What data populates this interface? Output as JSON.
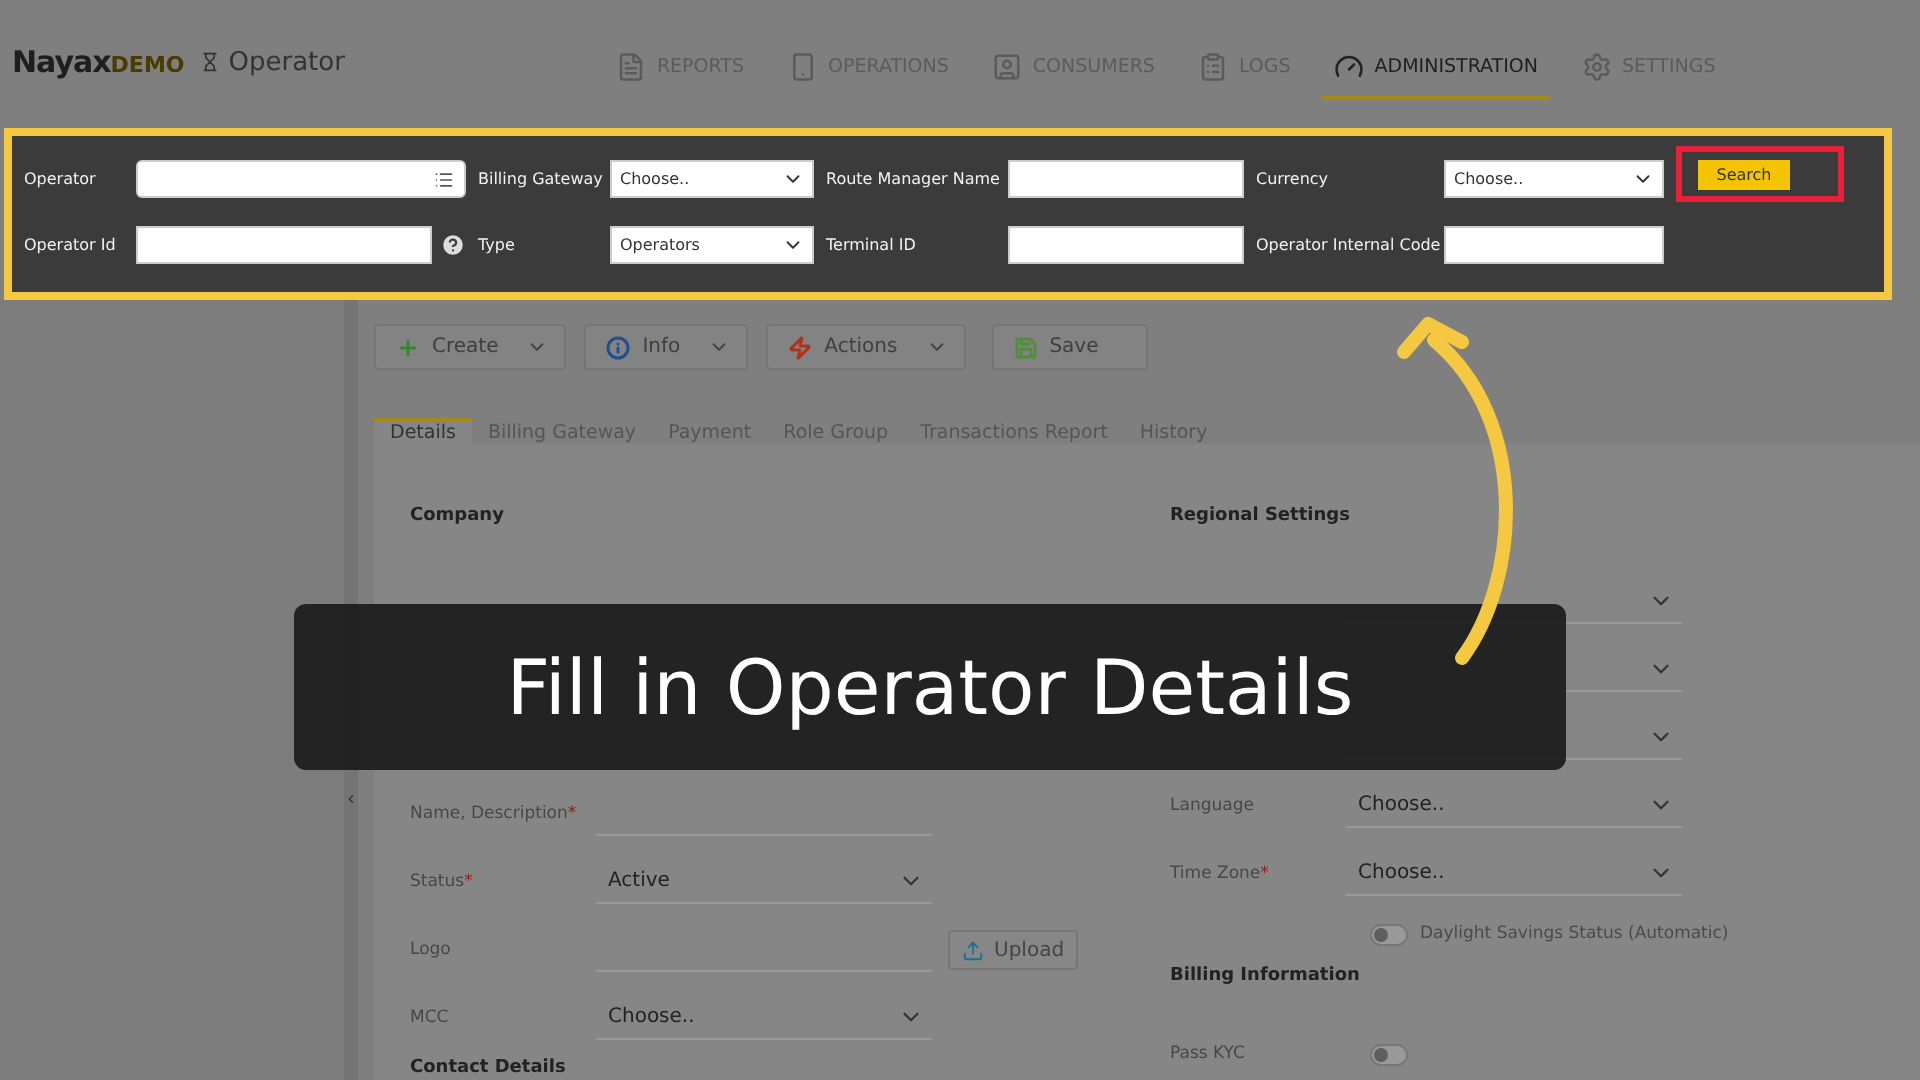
{
  "header": {
    "logo": "Nayax",
    "logo_badge": "DEMO",
    "app_name": "Operator"
  },
  "nav": [
    {
      "label": "REPORTS",
      "selected": false
    },
    {
      "label": "OPERATIONS",
      "selected": false
    },
    {
      "label": "CONSUMERS",
      "selected": false
    },
    {
      "label": "LOGS",
      "selected": false
    },
    {
      "label": "ADMINISTRATION",
      "selected": true
    },
    {
      "label": "SETTINGS",
      "selected": false
    }
  ],
  "search_panel": {
    "fields": [
      {
        "label": "Operator",
        "kind": "lookup"
      },
      {
        "label": "Billing Gateway",
        "kind": "select",
        "value": "Choose.."
      },
      {
        "label": "Route Manager Name",
        "kind": "text"
      },
      {
        "label": "Currency",
        "kind": "select",
        "value": "Choose.."
      },
      {
        "label": "Operator Id",
        "kind": "help"
      },
      {
        "label": "Type",
        "kind": "select",
        "value": "Operators"
      },
      {
        "label": "Terminal ID",
        "kind": "text"
      },
      {
        "label": "Operator Internal Code",
        "kind": "text"
      }
    ],
    "search_button": "Search"
  },
  "toolbar": [
    {
      "label": "Create",
      "dropdown": true
    },
    {
      "label": "Info",
      "dropdown": true
    },
    {
      "label": "Actions",
      "dropdown": true
    },
    {
      "label": "Save",
      "dropdown": false
    }
  ],
  "tabs": [
    {
      "label": "Details",
      "selected": true
    },
    {
      "label": "Billing Gateway",
      "selected": false
    },
    {
      "label": "Payment",
      "selected": false
    },
    {
      "label": "Role Group",
      "selected": false
    },
    {
      "label": "Transactions Report",
      "selected": false
    },
    {
      "label": "History",
      "selected": false
    }
  ],
  "company": {
    "title": "Company",
    "fields": [
      {
        "label": "Name, Description",
        "required_mark": "*",
        "kind": "text"
      },
      {
        "label": "Status",
        "required_mark": "*",
        "kind": "select",
        "value": "Active"
      },
      {
        "label": "Logo",
        "kind": "upload",
        "button": "Upload"
      },
      {
        "label": "MCC",
        "kind": "select",
        "value": "Choose.."
      }
    ]
  },
  "contact_details": {
    "title": "Contact Details"
  },
  "regional_settings": {
    "title": "Regional Settings",
    "fields": [
      {
        "label": "Language",
        "kind": "select",
        "value": "Choose.."
      },
      {
        "label": "Time Zone",
        "required_mark": "*",
        "kind": "select",
        "value": "Choose.."
      },
      {
        "label": "Daylight Savings Status (Automatic)",
        "kind": "toggle",
        "on": false
      }
    ]
  },
  "billing_information": {
    "title": "Billing Information",
    "fields": [
      {
        "label": "Pass KYC",
        "kind": "toggle",
        "on": false
      }
    ]
  },
  "banner": {
    "text": "Fill in Operator Details"
  }
}
